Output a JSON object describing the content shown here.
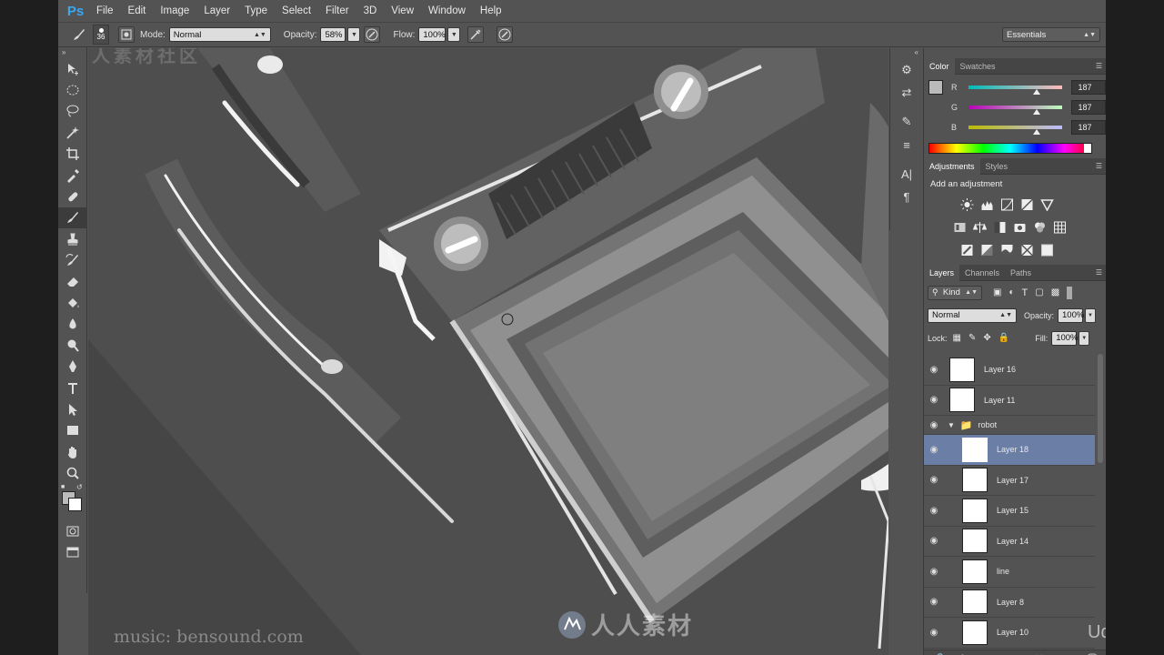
{
  "app": {
    "logo": "Ps",
    "menu": [
      "File",
      "Edit",
      "Image",
      "Layer",
      "Type",
      "Select",
      "Filter",
      "3D",
      "View",
      "Window",
      "Help"
    ]
  },
  "options": {
    "brush_size": "36",
    "mode_label": "Mode:",
    "mode_value": "Normal",
    "opacity_label": "Opacity:",
    "opacity_value": "58%",
    "flow_label": "Flow:",
    "flow_value": "100%",
    "workspace": "Essentials"
  },
  "color_panel": {
    "tabs": [
      "Color",
      "Swatches"
    ],
    "channels": [
      {
        "label": "R",
        "value": "187",
        "level": 0.73
      },
      {
        "label": "G",
        "value": "187",
        "level": 0.73
      },
      {
        "label": "B",
        "value": "187",
        "level": 0.73
      }
    ]
  },
  "adjustments_panel": {
    "tabs": [
      "Adjustments",
      "Styles"
    ],
    "title": "Add an adjustment"
  },
  "layers_panel": {
    "tabs": [
      "Layers",
      "Channels",
      "Paths"
    ],
    "filter_kind": "Kind",
    "blend_mode": "Normal",
    "opacity_label": "Opacity:",
    "opacity_value": "100%",
    "lock_label": "Lock:",
    "fill_label": "Fill:",
    "fill_value": "100%",
    "layers": [
      {
        "name": "Layer 16",
        "type": "layer"
      },
      {
        "name": "Layer 11",
        "type": "layer"
      },
      {
        "name": "robot",
        "type": "group"
      },
      {
        "name": "Layer 18",
        "type": "layer",
        "selected": true
      },
      {
        "name": "Layer 17",
        "type": "layer"
      },
      {
        "name": "Layer 15",
        "type": "layer"
      },
      {
        "name": "Layer 14",
        "type": "layer"
      },
      {
        "name": "line",
        "type": "layer"
      },
      {
        "name": "Layer 8",
        "type": "layer"
      },
      {
        "name": "Layer 10",
        "type": "layer"
      }
    ]
  },
  "overlays": {
    "music_credit": "music: bensound.com",
    "watermark_center": "人人素材",
    "watermark_top_left": "人人素材社区",
    "brand": "Udemy"
  }
}
